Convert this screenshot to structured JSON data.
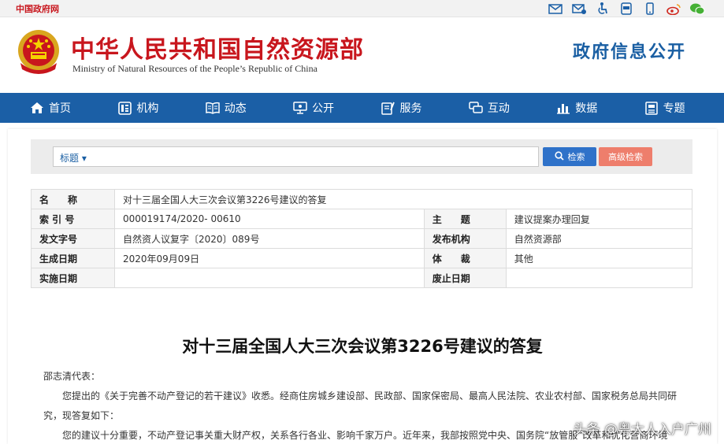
{
  "topbar": {
    "gov_link": "中国政府网",
    "icons": [
      "mail-icon",
      "email-alt-icon",
      "accessibility-icon",
      "app-icon",
      "mobile-icon",
      "weibo-icon",
      "wechat-icon"
    ]
  },
  "header": {
    "title_cn": "中华人民共和国自然资源部",
    "title_en": "Ministry of Natural Resources of the People’s Republic of China",
    "gov_info": "政府信息公开"
  },
  "nav": {
    "items": [
      {
        "label": "首页",
        "icon": "home-icon"
      },
      {
        "label": "机构",
        "icon": "org-icon"
      },
      {
        "label": "动态",
        "icon": "book-icon"
      },
      {
        "label": "公开",
        "icon": "monitor-icon"
      },
      {
        "label": "服务",
        "icon": "service-icon"
      },
      {
        "label": "互动",
        "icon": "chat-icon"
      },
      {
        "label": "数据",
        "icon": "chart-icon"
      },
      {
        "label": "专题",
        "icon": "topic-icon"
      }
    ]
  },
  "search": {
    "category": "标题",
    "input_value": "",
    "search_label": "检索",
    "advanced_label": "高级检索"
  },
  "info": {
    "name_label": "名　　称",
    "name_value": "对十三届全国人大三次会议第3226号建议的答复",
    "index_label": "索 引 号",
    "index_value": "000019174/2020- 00610",
    "subject_label": "主　　题",
    "subject_value": "建议提案办理回复",
    "docno_label": "发文字号",
    "docno_value": "自然资人议复字〔2020〕089号",
    "publisher_label": "发布机构",
    "publisher_value": "自然资源部",
    "date_label": "生成日期",
    "date_value": "2020年09月09日",
    "genre_label": "体　　裁",
    "genre_value": "其他",
    "effective_label": "实施日期",
    "effective_value": "",
    "repeal_label": "废止日期",
    "repeal_value": ""
  },
  "doc": {
    "title": "对十三届全国人大三次会议第3226号建议的答复",
    "salutation": "邵志清代表：",
    "para1": "您提出的《关于完善不动产登记的若干建议》收悉。经商住房城乡建设部、民政部、国家保密局、最高人民法院、农业农村部、国家税务总局共同研",
    "para1_cont": "究，现答复如下：",
    "para2": "您的建议十分重要，不动产登记事关重大财产权，关系各行各业、影响千家万户。近年来，我部按照党中央、国务院“放管服”改革和优化营商环境"
  },
  "watermark": "头条 @粤大人入户广州",
  "colors": {
    "brand_red": "#c8161d",
    "nav_blue": "#1b5fa6",
    "search_blue": "#2f72c9",
    "advanced_orange": "#ee7e6c"
  }
}
